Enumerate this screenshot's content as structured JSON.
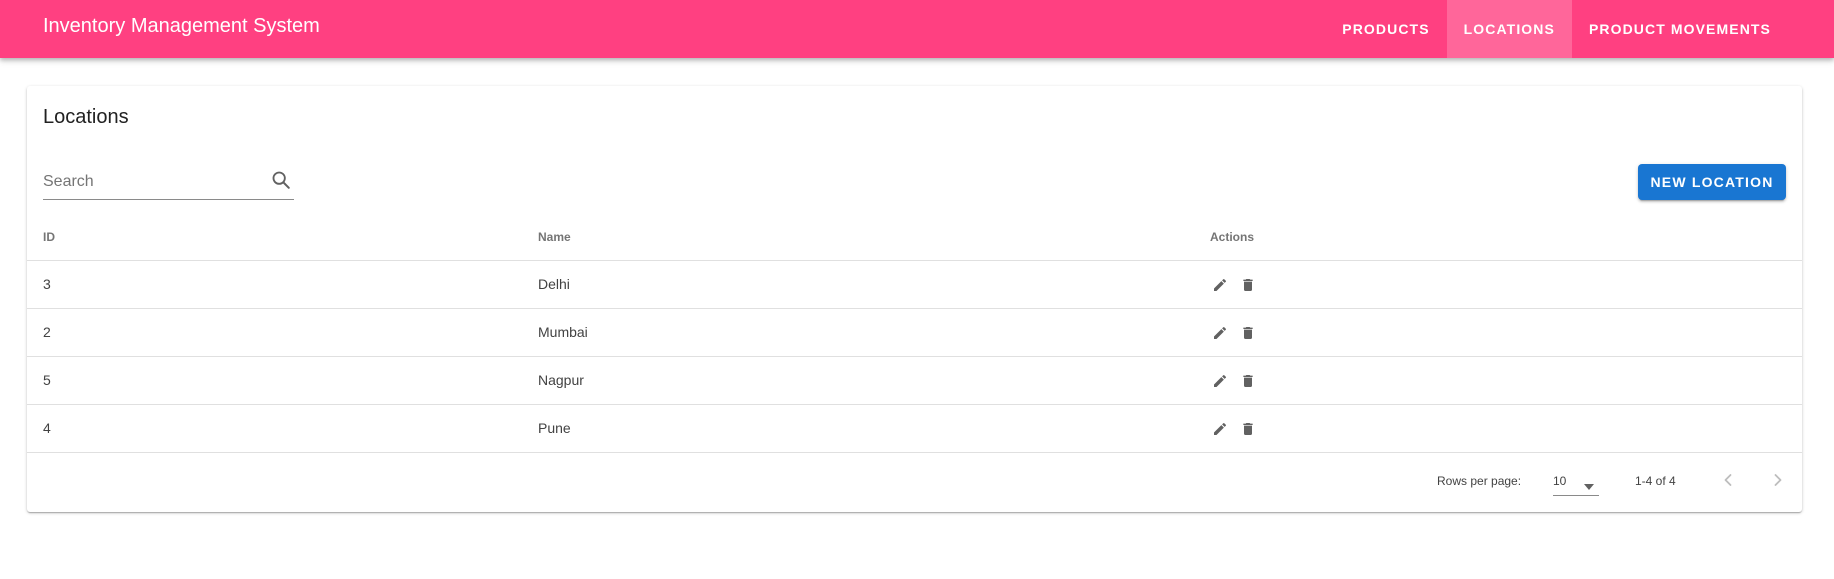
{
  "appbar": {
    "title": "Inventory Management System",
    "tabs": [
      {
        "label": "PRODUCTS",
        "active": false
      },
      {
        "label": "LOCATIONS",
        "active": true
      },
      {
        "label": "PRODUCT MOVEMENTS",
        "active": false
      }
    ],
    "color": "#ff4081"
  },
  "page": {
    "title": "Locations"
  },
  "search": {
    "placeholder": "Search",
    "value": "",
    "icon": "search-icon"
  },
  "new_button": {
    "label": "NEW LOCATION",
    "color": "#1976d2"
  },
  "table": {
    "columns": [
      "ID",
      "Name",
      "Actions"
    ],
    "rows": [
      {
        "id": "3",
        "name": "Delhi"
      },
      {
        "id": "2",
        "name": "Mumbai"
      },
      {
        "id": "5",
        "name": "Nagpur"
      },
      {
        "id": "4",
        "name": "Pune"
      }
    ],
    "row_actions": [
      "edit-icon",
      "delete-icon"
    ]
  },
  "pagination": {
    "rows_per_page_label": "Rows per page:",
    "rows_per_page_value": "10",
    "range": "1-4 of 4"
  }
}
